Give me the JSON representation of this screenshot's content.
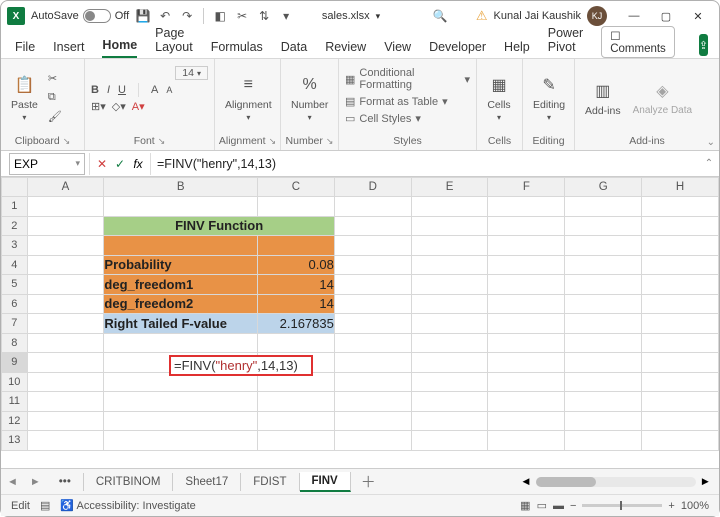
{
  "titlebar": {
    "autosave_label": "AutoSave",
    "off": "Off",
    "filename": "sales.xlsx",
    "username": "Kunal Jai Kaushik",
    "initials": "KJ"
  },
  "tabs": {
    "file": "File",
    "insert": "Insert",
    "home": "Home",
    "page": "Page Layout",
    "formulas": "Formulas",
    "data": "Data",
    "review": "Review",
    "view": "View",
    "dev": "Developer",
    "help": "Help",
    "pp": "Power Pivot",
    "comments": "Comments"
  },
  "ribbon": {
    "clipboard": {
      "paste": "Paste",
      "label": "Clipboard"
    },
    "font": {
      "b": "B",
      "i": "I",
      "u": "U",
      "fontsize": "14",
      "label": "Font"
    },
    "alignment": {
      "label": "Alignment",
      "title": "Alignment"
    },
    "number": {
      "label": "Number",
      "title": "Number",
      "sym": "%"
    },
    "styles": {
      "cond": "Conditional Formatting",
      "table": "Format as Table",
      "cell": "Cell Styles",
      "label": "Styles"
    },
    "cells": {
      "title": "Cells",
      "label": "Cells"
    },
    "editing": {
      "title": "Editing",
      "label": "Editing"
    },
    "addins": {
      "title": "Add-ins",
      "analyze": "Analyze Data",
      "label": "Add-ins"
    }
  },
  "fxbar": {
    "namebox": "EXP",
    "fx": "fx",
    "formula": "=FINV(\"henry\",14,13)"
  },
  "cols": [
    "A",
    "B",
    "C",
    "D",
    "E",
    "F",
    "G",
    "H"
  ],
  "rows": [
    "1",
    "2",
    "3",
    "4",
    "5",
    "6",
    "7",
    "8",
    "9",
    "10",
    "11",
    "12",
    "13"
  ],
  "sheet": {
    "title": "FINV Function",
    "r4": {
      "label": "Probability",
      "val": "0.08"
    },
    "r5": {
      "label": "deg_freedom1",
      "val": "14"
    },
    "r6": {
      "label": "deg_freedom2",
      "val": "14"
    },
    "r7": {
      "label": "Right Tailed F-value",
      "val": "2.167835"
    },
    "edit_prefix": "=FINV(",
    "edit_str": "\"henry\"",
    "edit_suffix": ",14,13)"
  },
  "sheettabs": {
    "t1": "CRITBINOM",
    "t2": "Sheet17",
    "t3": "FDIST",
    "t4": "FINV",
    "dots": "•••"
  },
  "status": {
    "mode": "Edit",
    "acc": "Accessibility: Investigate",
    "zoom": "100%"
  }
}
